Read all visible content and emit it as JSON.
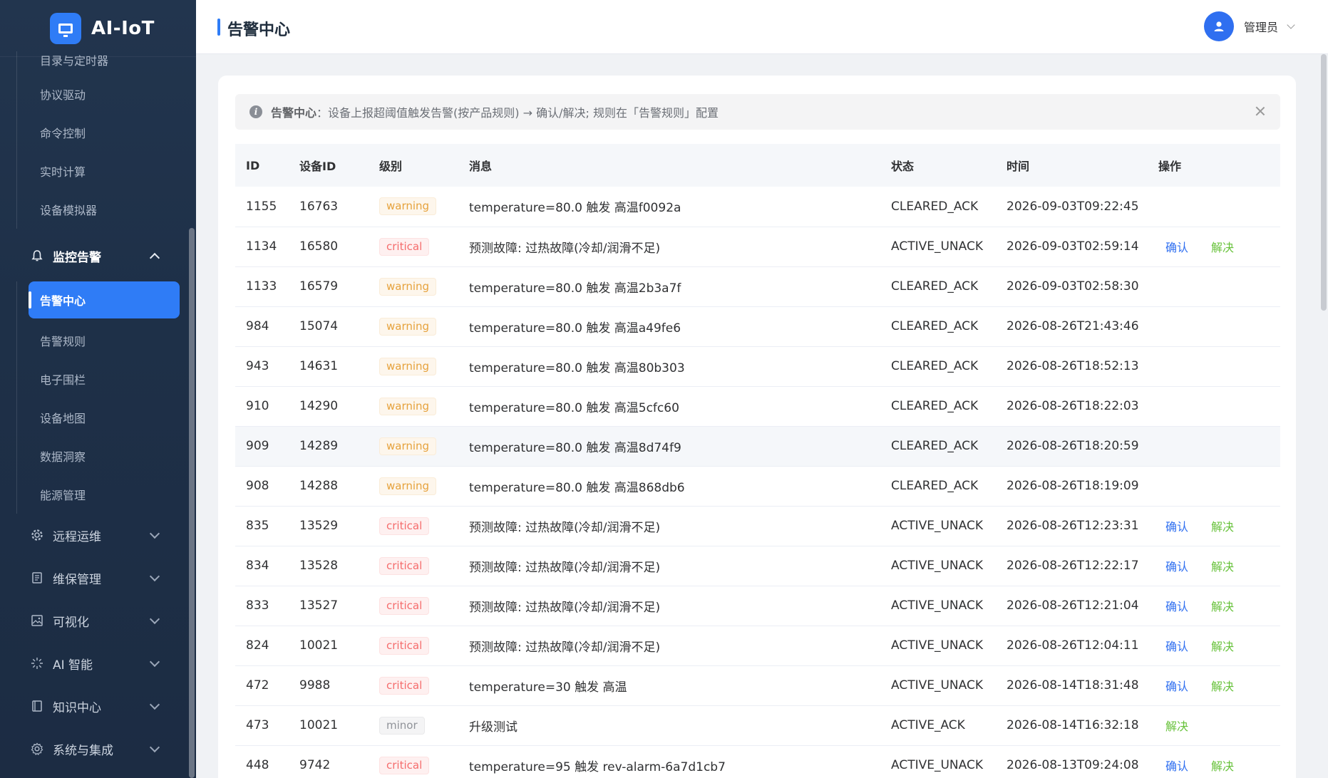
{
  "app": {
    "name": "AI-IoT"
  },
  "sidebar": {
    "top_sub_items": [
      {
        "label": "目录与定时器"
      },
      {
        "label": "协议驱动"
      },
      {
        "label": "命令控制"
      },
      {
        "label": "实时计算"
      },
      {
        "label": "设备模拟器"
      }
    ],
    "monitor_group": {
      "label": "监控告警",
      "icon": "bell-icon"
    },
    "monitor_items": [
      {
        "label": "告警中心",
        "active": true
      },
      {
        "label": "告警规则"
      },
      {
        "label": "电子围栏"
      },
      {
        "label": "设备地图"
      },
      {
        "label": "数据洞察"
      },
      {
        "label": "能源管理"
      }
    ],
    "groups": [
      {
        "label": "远程运维",
        "icon": "gear-icon"
      },
      {
        "label": "维保管理",
        "icon": "document-icon"
      },
      {
        "label": "可视化",
        "icon": "image-icon"
      },
      {
        "label": "AI 智能",
        "icon": "sparkle-icon"
      },
      {
        "label": "知识中心",
        "icon": "book-icon"
      },
      {
        "label": "系统与集成",
        "icon": "settings-icon"
      }
    ]
  },
  "header": {
    "title": "告警中心",
    "user": "管理员"
  },
  "alert": {
    "title": "告警中心",
    "text": "：设备上报超阈值触发告警(按产品规则) → 确认/解决; 规则在「告警规则」配置"
  },
  "table": {
    "columns": [
      "ID",
      "设备ID",
      "级别",
      "消息",
      "状态",
      "时间",
      "操作"
    ],
    "action_labels": {
      "ack": "确认",
      "resolve": "解决"
    },
    "rows": [
      {
        "id": "1155",
        "device": "16763",
        "level": "warning",
        "message": "temperature=80.0 触发 高温f0092a",
        "status": "CLEARED_ACK",
        "time": "2026-09-03T09:22:45",
        "actions": []
      },
      {
        "id": "1134",
        "device": "16580",
        "level": "critical",
        "message": "预测故障: 过热故障(冷却/润滑不足)",
        "status": "ACTIVE_UNACK",
        "time": "2026-09-03T02:59:14",
        "actions": [
          "ack",
          "resolve"
        ]
      },
      {
        "id": "1133",
        "device": "16579",
        "level": "warning",
        "message": "temperature=80.0 触发 高温2b3a7f",
        "status": "CLEARED_ACK",
        "time": "2026-09-03T02:58:30",
        "actions": []
      },
      {
        "id": "984",
        "device": "15074",
        "level": "warning",
        "message": "temperature=80.0 触发 高温a49fe6",
        "status": "CLEARED_ACK",
        "time": "2026-08-26T21:43:46",
        "actions": []
      },
      {
        "id": "943",
        "device": "14631",
        "level": "warning",
        "message": "temperature=80.0 触发 高温80b303",
        "status": "CLEARED_ACK",
        "time": "2026-08-26T18:52:13",
        "actions": []
      },
      {
        "id": "910",
        "device": "14290",
        "level": "warning",
        "message": "temperature=80.0 触发 高温5cfc60",
        "status": "CLEARED_ACK",
        "time": "2026-08-26T18:22:03",
        "actions": []
      },
      {
        "id": "909",
        "device": "14289",
        "level": "warning",
        "message": "temperature=80.0 触发 高温8d74f9",
        "status": "CLEARED_ACK",
        "time": "2026-08-26T18:20:59",
        "actions": [],
        "hover": true
      },
      {
        "id": "908",
        "device": "14288",
        "level": "warning",
        "message": "temperature=80.0 触发 高温868db6",
        "status": "CLEARED_ACK",
        "time": "2026-08-26T18:19:09",
        "actions": []
      },
      {
        "id": "835",
        "device": "13529",
        "level": "critical",
        "message": "预测故障: 过热故障(冷却/润滑不足)",
        "status": "ACTIVE_UNACK",
        "time": "2026-08-26T12:23:31",
        "actions": [
          "ack",
          "resolve"
        ]
      },
      {
        "id": "834",
        "device": "13528",
        "level": "critical",
        "message": "预测故障: 过热故障(冷却/润滑不足)",
        "status": "ACTIVE_UNACK",
        "time": "2026-08-26T12:22:17",
        "actions": [
          "ack",
          "resolve"
        ]
      },
      {
        "id": "833",
        "device": "13527",
        "level": "critical",
        "message": "预测故障: 过热故障(冷却/润滑不足)",
        "status": "ACTIVE_UNACK",
        "time": "2026-08-26T12:21:04",
        "actions": [
          "ack",
          "resolve"
        ]
      },
      {
        "id": "824",
        "device": "10021",
        "level": "critical",
        "message": "预测故障: 过热故障(冷却/润滑不足)",
        "status": "ACTIVE_UNACK",
        "time": "2026-08-26T12:04:11",
        "actions": [
          "ack",
          "resolve"
        ]
      },
      {
        "id": "472",
        "device": "9988",
        "level": "critical",
        "message": "temperature=30 触发 高温",
        "status": "ACTIVE_UNACK",
        "time": "2026-08-14T18:31:48",
        "actions": [
          "ack",
          "resolve"
        ]
      },
      {
        "id": "473",
        "device": "10021",
        "level": "minor",
        "message": "升级测试",
        "status": "ACTIVE_ACK",
        "time": "2026-08-14T16:32:18",
        "actions": [
          "resolve"
        ]
      },
      {
        "id": "448",
        "device": "9742",
        "level": "critical",
        "message": "temperature=95 触发 rev-alarm-6a7d1cb7",
        "status": "ACTIVE_UNACK",
        "time": "2026-08-13T09:24:08",
        "actions": [
          "ack",
          "resolve"
        ]
      }
    ]
  }
}
